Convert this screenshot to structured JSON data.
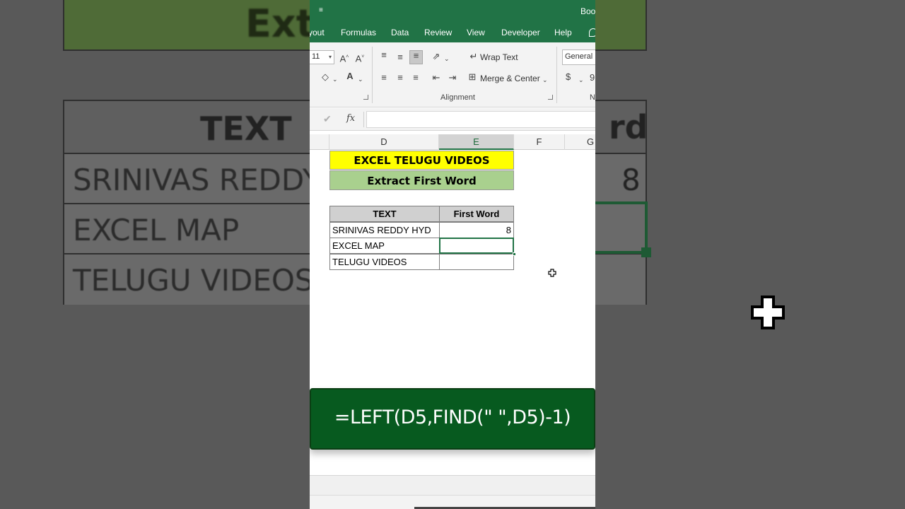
{
  "background": {
    "banner_text": "Extract",
    "table_header_left": "TEXT",
    "table_header_right_fragment": "rd",
    "rows": [
      "SRINIVAS REDDY",
      "EXCEL MAP",
      "TELUGU VIDEOS"
    ],
    "row1_value": "8"
  },
  "window": {
    "title_fragment": "Boo",
    "menu_items": [
      "yout",
      "Formulas",
      "Data",
      "Review",
      "View",
      "Developer",
      "Help"
    ]
  },
  "ribbon": {
    "font_size": "11",
    "wrap_text_label": "Wrap Text",
    "merge_center_label": "Merge & Center",
    "alignment_group_label": "Alignment",
    "number_format": "General",
    "number_group_fragment": "N",
    "currency_symbol": "$",
    "percent_fragment": "9"
  },
  "formula_bar": {
    "fx_label": "fx",
    "value": ""
  },
  "columns": [
    "D",
    "E",
    "F",
    "G"
  ],
  "active_column": "E",
  "sheet": {
    "title_banner": "EXCEL TELUGU VIDEOS",
    "subtitle_banner": "Extract First Word",
    "table_headers": [
      "TEXT",
      "First Word"
    ],
    "rows": [
      {
        "text": "SRINIVAS REDDY HYD",
        "first_word": "8"
      },
      {
        "text": "EXCEL MAP",
        "first_word": ""
      },
      {
        "text": "TELUGU VIDEOS",
        "first_word": ""
      }
    ]
  },
  "formula_overlay": "=LEFT(D5,FIND(\" \",D5)-1)",
  "colors": {
    "excel_green": "#217346",
    "title_yellow": "#ffff00",
    "subtitle_green": "#a9d08e",
    "overlay_green": "#075a1f"
  }
}
